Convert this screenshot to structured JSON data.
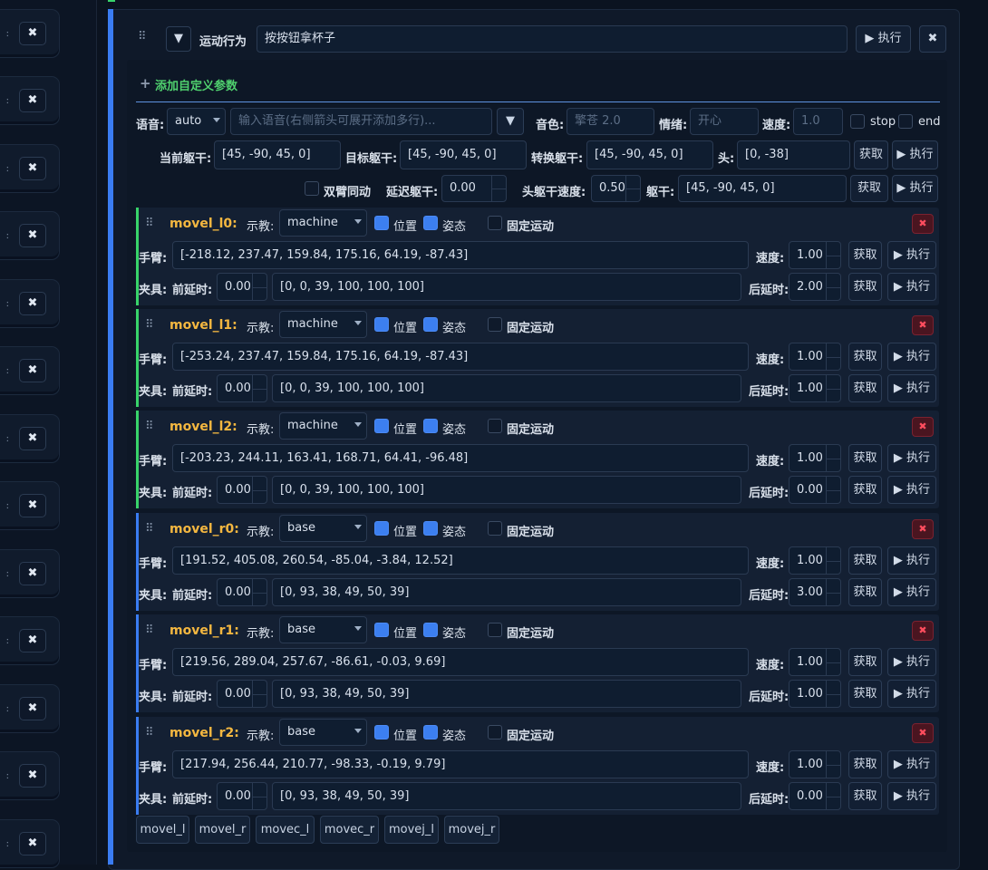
{
  "sidebar": {
    "close_label": "✖",
    "stub_label": ":"
  },
  "header": {
    "collapse_icon": "▼",
    "type_label": "运动行为",
    "name_value": "按按钮拿杯子",
    "exec_label": "▶ 执行",
    "close_label": "✖"
  },
  "add_param_label": "添加自定义参数",
  "voice": {
    "lang_label": "语音:",
    "lang_value": "auto",
    "input_placeholder": "输入语音(右侧箭头可展开添加多行)...",
    "expand_icon": "▼",
    "timbre_label": "音色:",
    "timbre_placeholder": "擎苍 2.0",
    "emotion_label": "情绪:",
    "emotion_placeholder": "开心",
    "speed_label": "速度:",
    "speed_placeholder": "1.0",
    "stop_label": "stop",
    "end_label": "end"
  },
  "torso": {
    "current_label": "当前躯干:",
    "current_value": "[45, -90, 45, 0]",
    "target_label": "目标躯干:",
    "target_value": "[45, -90, 45, 0]",
    "convert_label": "转换躯干:",
    "convert_value": "[45, -90, 45, 0]",
    "head_label": "头:",
    "head_value": "[0, -38]",
    "get_label": "获取",
    "exec_label": "▶ 执行",
    "dual_arm_label": "双臂同动",
    "delay_label": "延迟躯干:",
    "delay_value": "0.00",
    "head_speed_label": "头躯干速度:",
    "head_speed_value": "0.50",
    "torso_label": "躯干:",
    "torso_value": "[45, -90, 45, 0]"
  },
  "labels": {
    "teach": "示教:",
    "position": "位置",
    "pose": "姿态",
    "fixed": "固定运动",
    "arm": "手臂:",
    "speed": "速度:",
    "get": "获取",
    "exec": "▶ 执行",
    "gripper": "夹具:",
    "pre_delay": "前延时:",
    "post_delay": "后延时:",
    "delete": "✖"
  },
  "movements": [
    {
      "name": "movel_l0:",
      "mode": "machine",
      "arm": "[-218.12, 237.47, 159.84, 175.16, 64.19, -87.43]",
      "speed": "1.00",
      "pre": "0.00",
      "gripper": "[0, 0, 39, 100, 100, 100]",
      "post": "2.00",
      "color": "#38d36a"
    },
    {
      "name": "movel_l1:",
      "mode": "machine",
      "arm": "[-253.24, 237.47, 159.84, 175.16, 64.19, -87.43]",
      "speed": "1.00",
      "pre": "0.00",
      "gripper": "[0, 0, 39, 100, 100, 100]",
      "post": "1.00",
      "color": "#38d36a"
    },
    {
      "name": "movel_l2:",
      "mode": "machine",
      "arm": "[-203.23, 244.11, 163.41, 168.71, 64.41, -96.48]",
      "speed": "1.00",
      "pre": "0.00",
      "gripper": "[0, 0, 39, 100, 100, 100]",
      "post": "0.00",
      "color": "#38d36a"
    },
    {
      "name": "movel_r0:",
      "mode": "base",
      "arm": "[191.52, 405.08, 260.54, -85.04, -3.84, 12.52]",
      "speed": "1.00",
      "pre": "0.00",
      "gripper": "[0, 93, 38, 49, 50, 39]",
      "post": "3.00",
      "color": "#3a7cf2"
    },
    {
      "name": "movel_r1:",
      "mode": "base",
      "arm": "[219.56, 289.04, 257.67, -86.61, -0.03, 9.69]",
      "speed": "1.00",
      "pre": "0.00",
      "gripper": "[0, 93, 38, 49, 50, 39]",
      "post": "1.00",
      "color": "#3a7cf2"
    },
    {
      "name": "movel_r2:",
      "mode": "base",
      "arm": "[217.94, 256.44, 210.77, -98.33, -0.19, 9.79]",
      "speed": "1.00",
      "pre": "0.00",
      "gripper": "[0, 93, 38, 49, 50, 39]",
      "post": "0.00",
      "color": "#3a7cf2"
    }
  ],
  "add_buttons": [
    "movel_l",
    "movel_r",
    "movec_l",
    "movec_r",
    "movej_l",
    "movej_r"
  ]
}
